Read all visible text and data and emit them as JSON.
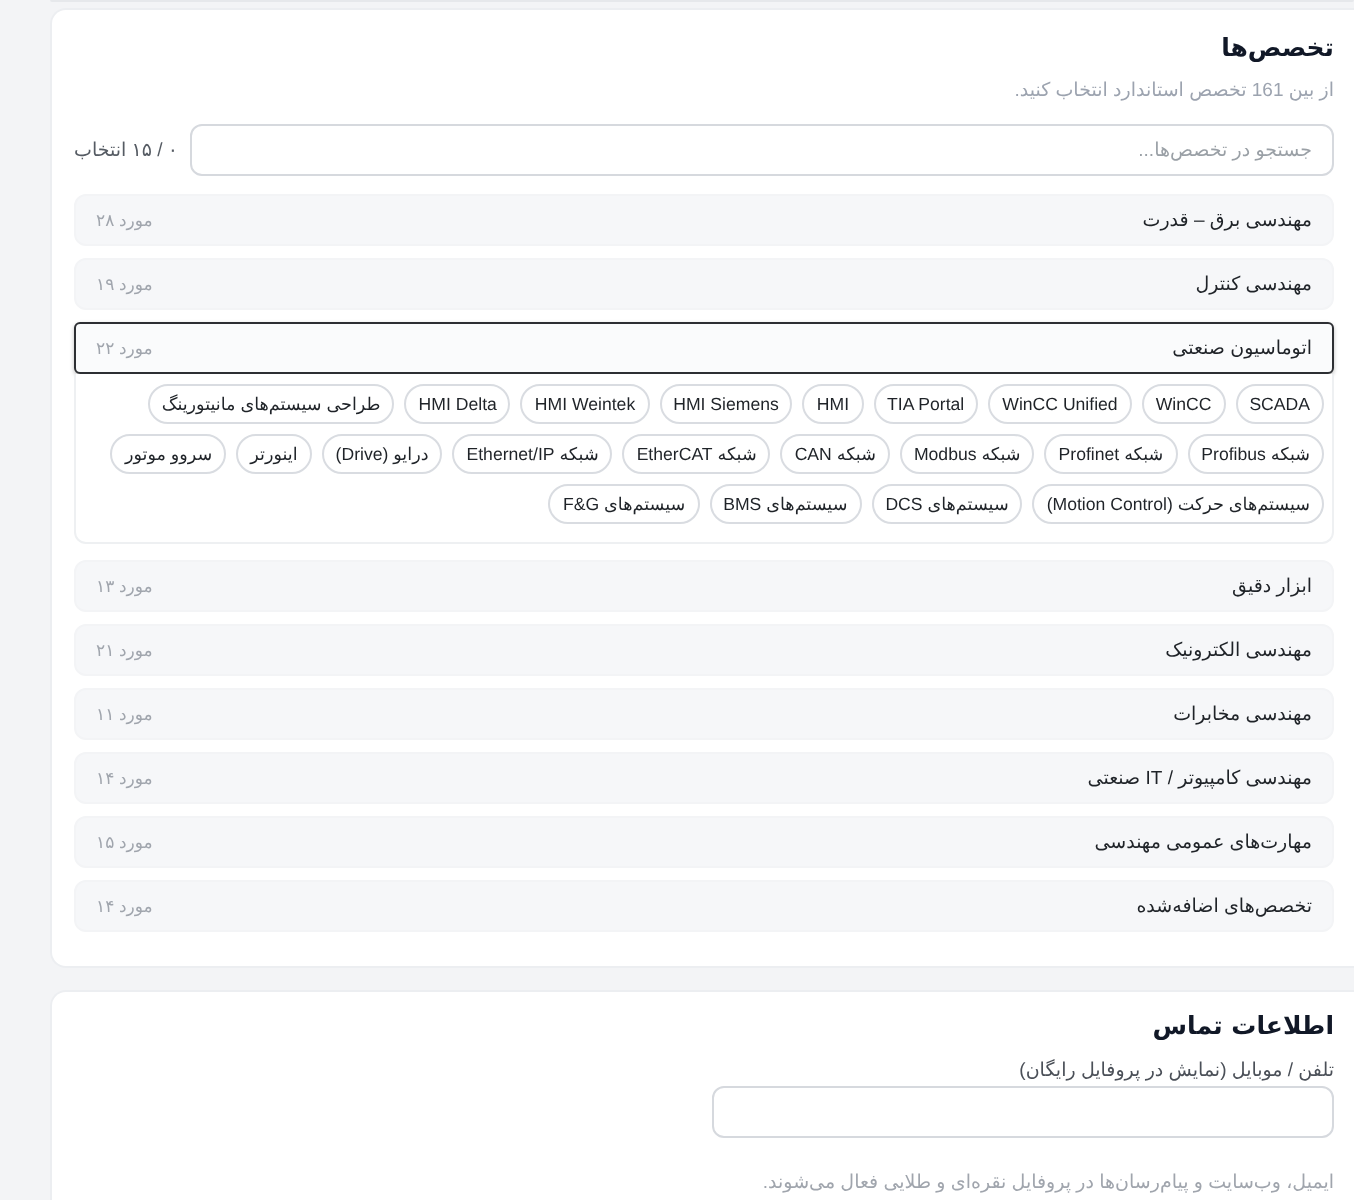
{
  "specialties": {
    "title": "تخصص‌ها",
    "subtitle": "از بین 161 تخصص استاندارد انتخاب کنید.",
    "search": {
      "placeholder": "جستجو در تخصص‌ها..."
    },
    "selection_count": "۰ / ۱۵ انتخاب",
    "categories": [
      {
        "name": "مهندسی برق – قدرت",
        "count": "۲۸ مورد",
        "expanded": false
      },
      {
        "name": "مهندسی کنترل",
        "count": "۱۹ مورد",
        "expanded": false
      },
      {
        "name": "اتوماسیون صنعتی",
        "count": "۲۲ مورد",
        "expanded": true,
        "skills": [
          {
            "label": "SCADA",
            "selected": false
          },
          {
            "label": "WinCC",
            "selected": false
          },
          {
            "label": "WinCC Unified",
            "selected": false
          },
          {
            "label": "TIA Portal",
            "selected": false
          },
          {
            "label": "HMI",
            "selected": false
          },
          {
            "label": "HMI Siemens",
            "selected": false
          },
          {
            "label": "HMI Weintek",
            "selected": false
          },
          {
            "label": "HMI Delta",
            "selected": false
          },
          {
            "label": "طراحی سیستم‌های مانیتورینگ",
            "selected": false
          },
          {
            "label": "شبکه Profibus",
            "selected": false
          },
          {
            "label": "شبکه Profinet",
            "selected": false
          },
          {
            "label": "شبکه Modbus",
            "selected": false
          },
          {
            "label": "شبکه CAN",
            "selected": false
          },
          {
            "label": "شبکه EtherCAT",
            "selected": false
          },
          {
            "label": "شبکه Ethernet/IP",
            "selected": false
          },
          {
            "label": "درایو (Drive)",
            "selected": false
          },
          {
            "label": "اینورتر",
            "selected": false
          },
          {
            "label": "سروو موتور",
            "selected": false
          },
          {
            "label": "سیستم‌های حرکت (Motion Control)",
            "selected": false
          },
          {
            "label": "سیستم‌های DCS",
            "selected": false
          },
          {
            "label": "سیستم‌های BMS",
            "selected": false
          },
          {
            "label": "سیستم‌های F&G",
            "selected": false
          }
        ]
      },
      {
        "name": "ابزار دقیق",
        "count": "۱۳ مورد",
        "expanded": false
      },
      {
        "name": "مهندسی الکترونیک",
        "count": "۲۱ مورد",
        "expanded": false
      },
      {
        "name": "مهندسی مخابرات",
        "count": "۱۱ مورد",
        "expanded": false
      },
      {
        "name": "مهندسی کامپیوتر / IT صنعتی",
        "count": "۱۴ مورد",
        "expanded": false
      },
      {
        "name": "مهارت‌های عمومی مهندسی",
        "count": "۱۵ مورد",
        "expanded": false
      },
      {
        "name": "تخصص‌های اضافه‌شده",
        "count": "۱۴ مورد",
        "expanded": false
      }
    ]
  },
  "contact": {
    "title": "اطلاعات تماس",
    "phone": {
      "label": "تلفن / موبایل (نمایش در پروفایل رایگان)"
    },
    "note": "ایمیل، وب‌سایت و پیام‌رسان‌ها در پروفایل نقره‌ای و طلایی فعال می‌شوند."
  }
}
